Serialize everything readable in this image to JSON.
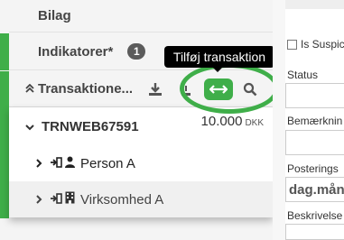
{
  "sections": {
    "bilag": "Bilag",
    "indikatorer": "Indikatorer*",
    "indikatorer_count": "1",
    "transaktioner": "Transaktione..."
  },
  "tooltip": "Tilføj transaktion",
  "transaction": {
    "id": "TRNWEB67591",
    "amount": "10.000",
    "currency": "DKK"
  },
  "parties": [
    {
      "label": "Person A",
      "icon": "person-icon"
    },
    {
      "label": "Virksomhed A",
      "icon": "building-icon"
    }
  ],
  "right_panel": {
    "checkbox_label": "Is Suspic",
    "status_label": "Status",
    "bemaerkning_label": "Bemærknin",
    "posterings_label": "Posterings",
    "posterings_value": "dag.mån",
    "beskrivelse_label": "Beskrivelse"
  },
  "colors": {
    "accent": "#3fae49",
    "badge": "#5b5b5b",
    "tooltip_bg": "#000000"
  }
}
